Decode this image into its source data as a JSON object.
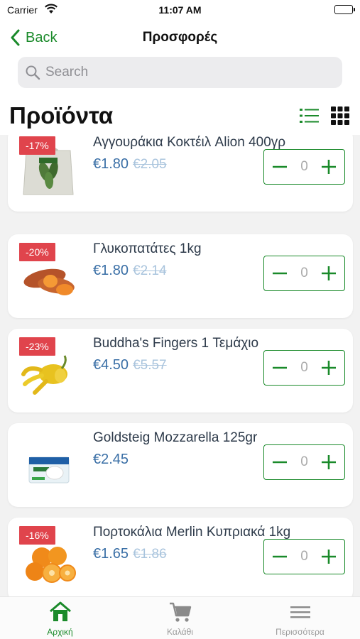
{
  "status_bar": {
    "carrier": "Carrier",
    "time": "11:07 AM"
  },
  "nav": {
    "back_label": "Back",
    "title": "Προσφορές"
  },
  "search": {
    "placeholder": "Search"
  },
  "section": {
    "title": "Προϊόντα"
  },
  "colors": {
    "accent": "#1a8a2a",
    "badge": "#e0444c",
    "price": "#3a6fa6",
    "old_price": "#a9c4dd"
  },
  "products": [
    {
      "name": "Αγγουράκια Κοκτέιλ Alion 400γρ",
      "price": "€1.80",
      "old_price": "€2.05",
      "discount": "-17%",
      "qty": "0",
      "image": "cucumber-bag-image"
    },
    {
      "name": "Γλυκοπατάτες 1kg",
      "price": "€1.80",
      "old_price": "€2.14",
      "discount": "-20%",
      "qty": "0",
      "image": "sweet-potato-image"
    },
    {
      "name": "Buddha's Fingers 1 Τεμάχιο",
      "price": "€4.50",
      "old_price": "€5.57",
      "discount": "-23%",
      "qty": "0",
      "image": "buddhas-hand-image"
    },
    {
      "name": "Goldsteig Mozzarella 125gr",
      "price": "€2.45",
      "old_price": "",
      "discount": "",
      "qty": "0",
      "image": "mozzarella-pack-image"
    },
    {
      "name": "Πορτοκάλια Merlin Κυπριακά 1kg",
      "price": "€1.65",
      "old_price": "€1.86",
      "discount": "-16%",
      "qty": "0",
      "image": "oranges-image"
    }
  ],
  "tabbar": {
    "home": "Αρχική",
    "cart": "Καλάθι",
    "more": "Περισσότερα"
  }
}
